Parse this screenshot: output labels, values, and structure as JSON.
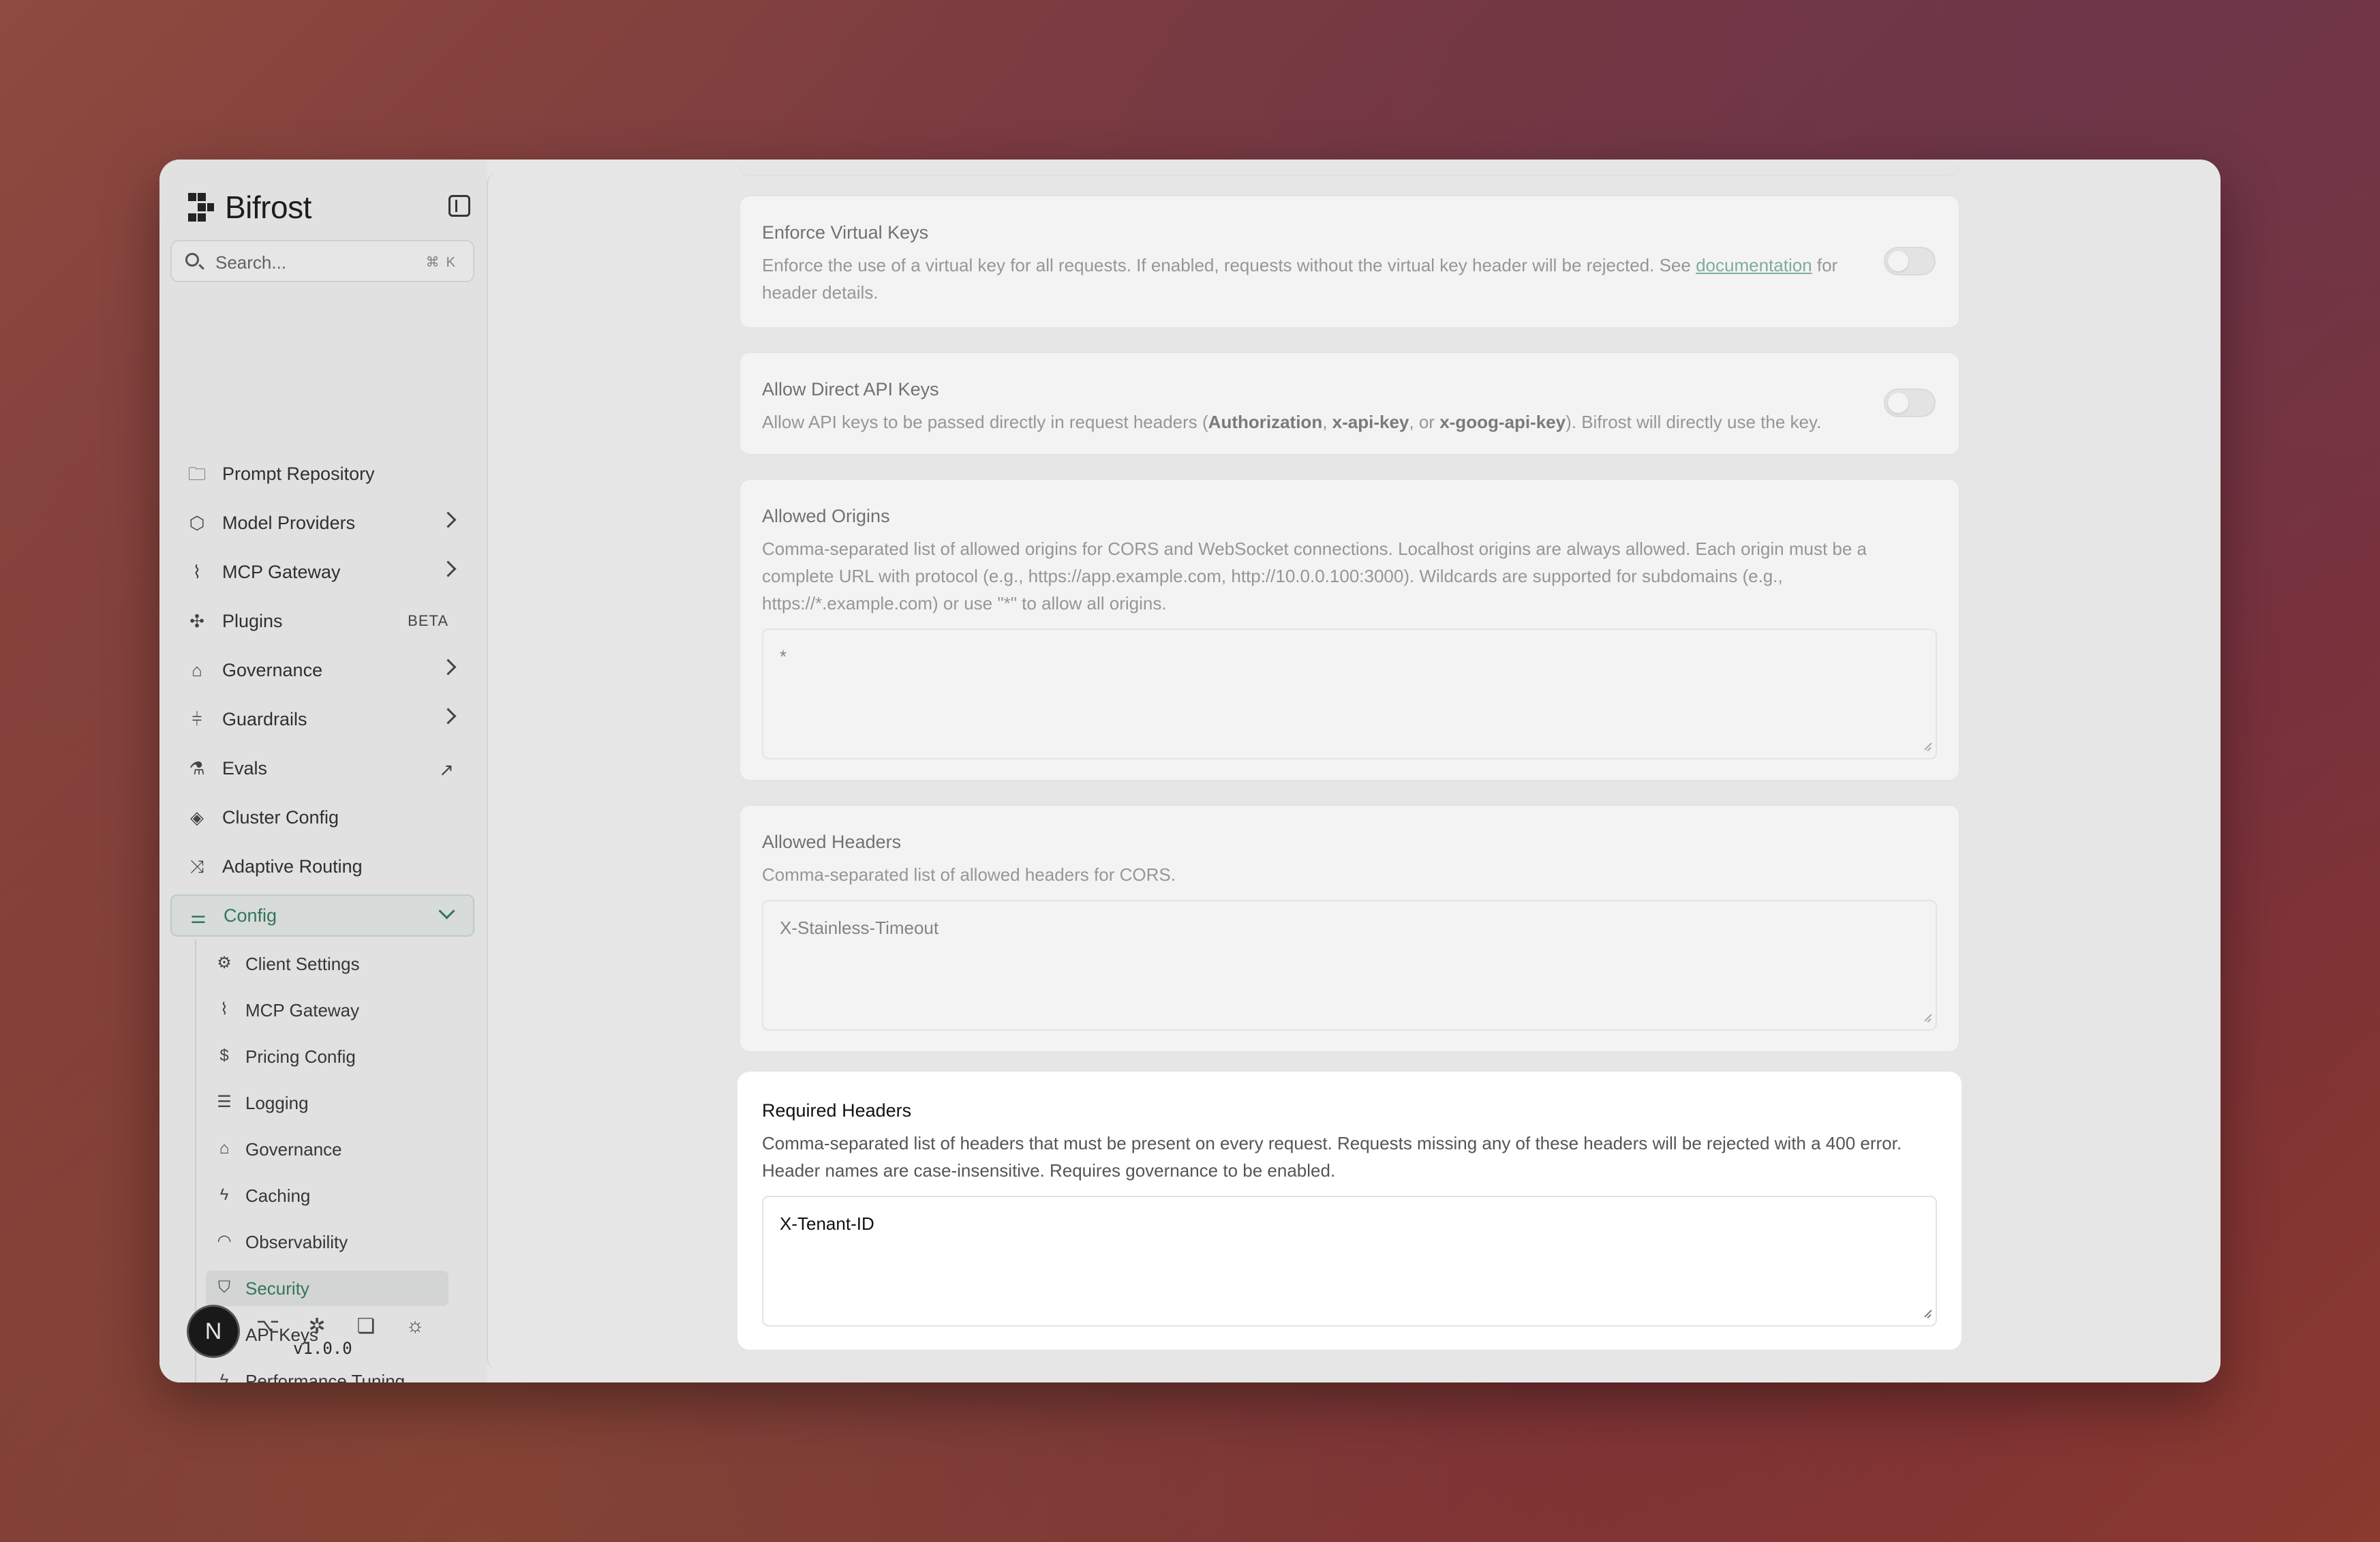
{
  "app": {
    "name": "Bifrost",
    "version": "v1.0.0",
    "avatar_initial": "N"
  },
  "search": {
    "placeholder": "Search...",
    "shortcut": "⌘K"
  },
  "sidebar": {
    "items": [
      {
        "label": "Prompt Repository",
        "icon": "folder-icon"
      },
      {
        "label": "Model Providers",
        "icon": "cube-icon"
      },
      {
        "label": "MCP Gateway",
        "icon": "mcp-icon"
      },
      {
        "label": "Plugins",
        "icon": "puzzle-icon",
        "badge": "BETA"
      },
      {
        "label": "Governance",
        "icon": "landmark-icon"
      },
      {
        "label": "Guardrails",
        "icon": "guardrail-icon"
      },
      {
        "label": "Evals",
        "icon": "flask-icon"
      },
      {
        "label": "Cluster Config",
        "icon": "layers-icon"
      },
      {
        "label": "Adaptive Routing",
        "icon": "shuffle-icon"
      },
      {
        "label": "Config",
        "icon": "sliders-icon"
      }
    ],
    "config_sub": [
      {
        "label": "Client Settings",
        "icon": "gear-icon"
      },
      {
        "label": "MCP Gateway",
        "icon": "mcp-icon"
      },
      {
        "label": "Pricing Config",
        "icon": "dollar-icon"
      },
      {
        "label": "Logging",
        "icon": "list-icon"
      },
      {
        "label": "Governance",
        "icon": "landmark-icon"
      },
      {
        "label": "Caching",
        "icon": "bolt-icon"
      },
      {
        "label": "Observability",
        "icon": "gauge-icon"
      },
      {
        "label": "Security",
        "icon": "shield-icon"
      },
      {
        "label": "API Keys",
        "icon": "key-icon"
      },
      {
        "label": "Performance Tuning",
        "icon": "bolt-icon"
      }
    ]
  },
  "cards": {
    "enforce_virtual_keys": {
      "title": "Enforce Virtual Keys",
      "desc_before": "Enforce the use of a virtual key for all requests. If enabled, requests without the virtual key header will be rejected. See ",
      "link": "documentation",
      "desc_after": " for header details.",
      "enabled": false
    },
    "allow_direct_api_keys": {
      "title": "Allow Direct API Keys",
      "desc_1": "Allow API keys to be passed directly in request headers (",
      "b1": "Authorization",
      "sep1": ", ",
      "b2": "x-api-key",
      "sep2": ", or ",
      "b3": "x-goog-api-key",
      "desc_2": "). Bifrost will directly use the key.",
      "enabled": false
    },
    "allowed_origins": {
      "title": "Allowed Origins",
      "desc": "Comma-separated list of allowed origins for CORS and WebSocket connections. Localhost origins are always allowed. Each origin must be a complete URL with protocol (e.g., https://app.example.com, http://10.0.0.100:3000). Wildcards are supported for subdomains (e.g., https://*.example.com) or use \"*\" to allow all origins.",
      "value": "*"
    },
    "allowed_headers": {
      "title": "Allowed Headers",
      "desc": "Comma-separated list of allowed headers for CORS.",
      "value": "X-Stainless-Timeout"
    },
    "required_headers": {
      "title": "Required Headers",
      "desc": "Comma-separated list of headers that must be present on every request. Requests missing any of these headers will be rejected with a 400 error. Header names are case-insensitive. Requires governance to be enabled.",
      "value": "X-Tenant-ID"
    }
  }
}
